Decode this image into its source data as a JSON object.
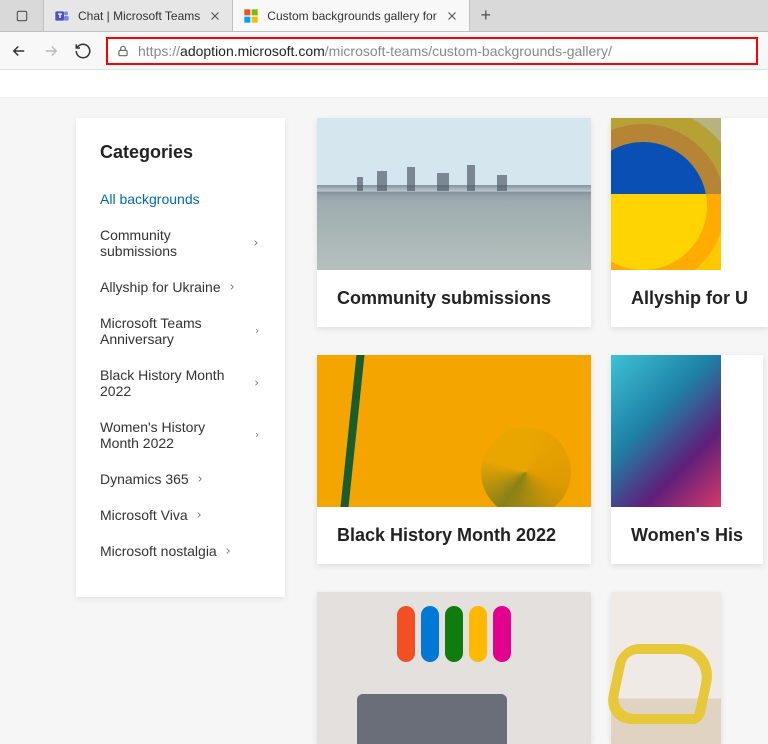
{
  "tabs": [
    {
      "title": "Chat | Microsoft Teams"
    },
    {
      "title": "Custom backgrounds gallery for"
    }
  ],
  "url": {
    "prefix": "https://",
    "host": "adoption.microsoft.com",
    "path": "/microsoft-teams/custom-backgrounds-gallery/"
  },
  "sidebar": {
    "title": "Categories",
    "items": [
      {
        "label": "All backgrounds",
        "active": true
      },
      {
        "label": "Community submissions"
      },
      {
        "label": "Allyship for Ukraine"
      },
      {
        "label": "Microsoft Teams Anniversary"
      },
      {
        "label": "Black History Month 2022"
      },
      {
        "label": "Women's History Month 2022"
      },
      {
        "label": "Dynamics 365"
      },
      {
        "label": "Microsoft Viva"
      },
      {
        "label": "Microsoft nostalgia"
      }
    ]
  },
  "cards": {
    "r0c0": "Community submissions",
    "r0c1": "Allyship for U",
    "r1c0": "Black History Month 2022",
    "r1c1": "Women's His"
  }
}
